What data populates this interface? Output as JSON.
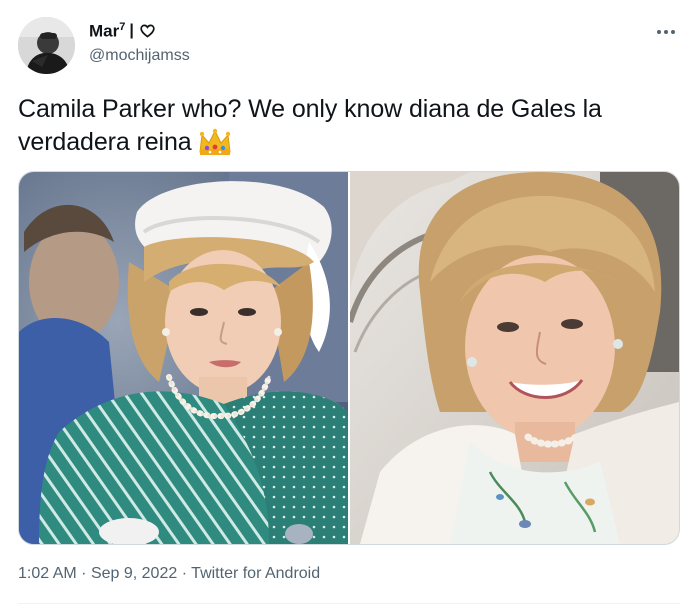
{
  "author": {
    "display_name": "Mar",
    "superscript": "7",
    "separator": "|",
    "handle": "@mochijamss"
  },
  "tweet": {
    "text": "Camila Parker who? We only know diana de Gales la verdadera reina",
    "emoji": "crown-emoji"
  },
  "meta": {
    "time": "1:02 AM",
    "dot1": "·",
    "date": "Sep 9, 2022",
    "dot2": "·",
    "source": "Twitter for Android"
  },
  "colors": {
    "text": "#0f1419",
    "secondary": "#536471",
    "border": "#cfd9de",
    "dress_green": "#2f8a80"
  }
}
